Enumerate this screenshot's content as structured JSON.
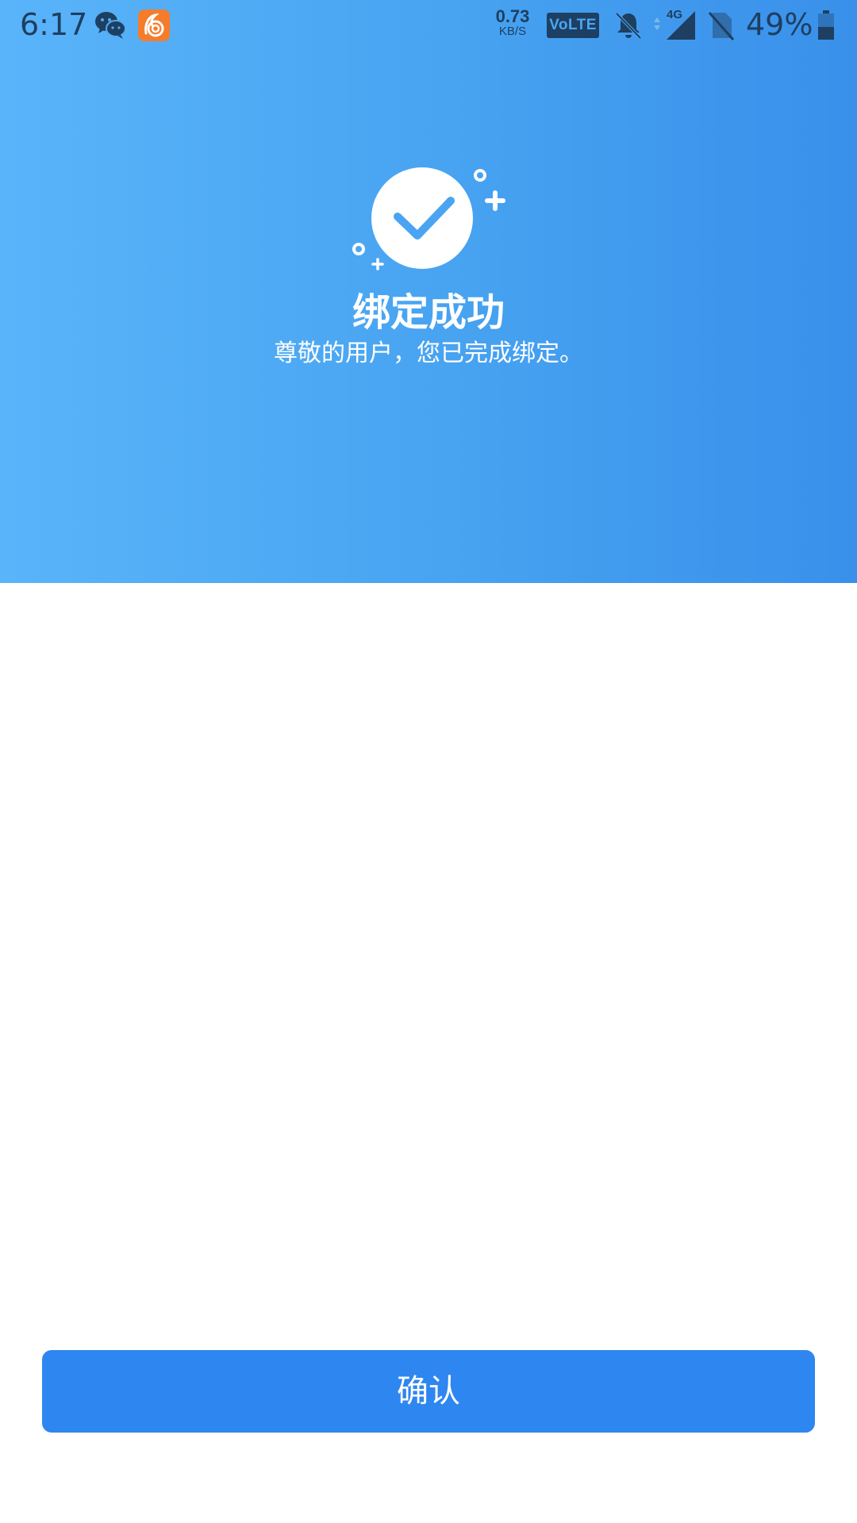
{
  "status_bar": {
    "time": "6:17",
    "network_speed_value": "0.73",
    "network_speed_unit": "KB/S",
    "volte_label": "VoLTE",
    "network_type": "4G",
    "battery_percent": "49%",
    "battery_level": 0.49,
    "icons": [
      "wechat-icon",
      "uc-browser-icon",
      "bell-muted-icon",
      "signal-icon",
      "no-sim-icon",
      "battery-icon"
    ]
  },
  "hero": {
    "title": "绑定成功",
    "subtitle": "尊敬的用户，您已完成绑定。",
    "icon": "check-circle-icon",
    "gradient_start": "#5ab4fa",
    "gradient_end": "#3990ea"
  },
  "actions": {
    "confirm_label": "确认",
    "confirm_color": "#2e86f0"
  }
}
